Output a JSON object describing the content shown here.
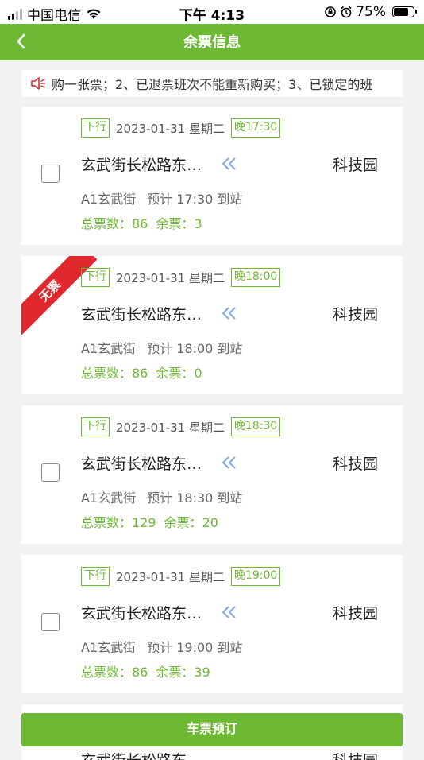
{
  "status_bar": {
    "carrier": "中国电信",
    "time": "下午 4:13",
    "battery": "75%"
  },
  "nav": {
    "title": "余票信息"
  },
  "notice": {
    "text": "购一张票；2、已退票班次不能重新购买；3、已锁定的班"
  },
  "schedules": [
    {
      "direction": "下行",
      "date": "2023-01-31 星期二",
      "time_tag": "晚17:30",
      "from": "玄武街长松路东…",
      "to": "科技园",
      "station": "A1玄武街",
      "eta": "预计 17:30 到站",
      "total": "总票数：86",
      "remaining": "余票：3",
      "sold_out": false
    },
    {
      "direction": "下行",
      "date": "2023-01-31 星期二",
      "time_tag": "晚18:00",
      "from": "玄武街长松路东…",
      "to": "科技园",
      "station": "A1玄武街",
      "eta": "预计 18:00 到站",
      "total": "总票数：86",
      "remaining": "余票：0",
      "sold_out": true,
      "sold_out_label": "无票"
    },
    {
      "direction": "下行",
      "date": "2023-01-31 星期二",
      "time_tag": "晚18:30",
      "from": "玄武街长松路东…",
      "to": "科技园",
      "station": "A1玄武街",
      "eta": "预计 18:30 到站",
      "total": "总票数：129",
      "remaining": "余票：20",
      "sold_out": false
    },
    {
      "direction": "下行",
      "date": "2023-01-31 星期二",
      "time_tag": "晚19:00",
      "from": "玄武街长松路东…",
      "to": "科技园",
      "station": "A1玄武街",
      "eta": "预计 19:00 到站",
      "total": "总票数：86",
      "remaining": "余票：39",
      "sold_out": false
    }
  ],
  "partial_card": {
    "from": "玄武街长松路东",
    "to": "科技园"
  },
  "book_button": {
    "label": "车票预订"
  },
  "colors": {
    "accent": "#6db933",
    "sold_out": "#e1282e",
    "arrow": "#8aaee0"
  }
}
